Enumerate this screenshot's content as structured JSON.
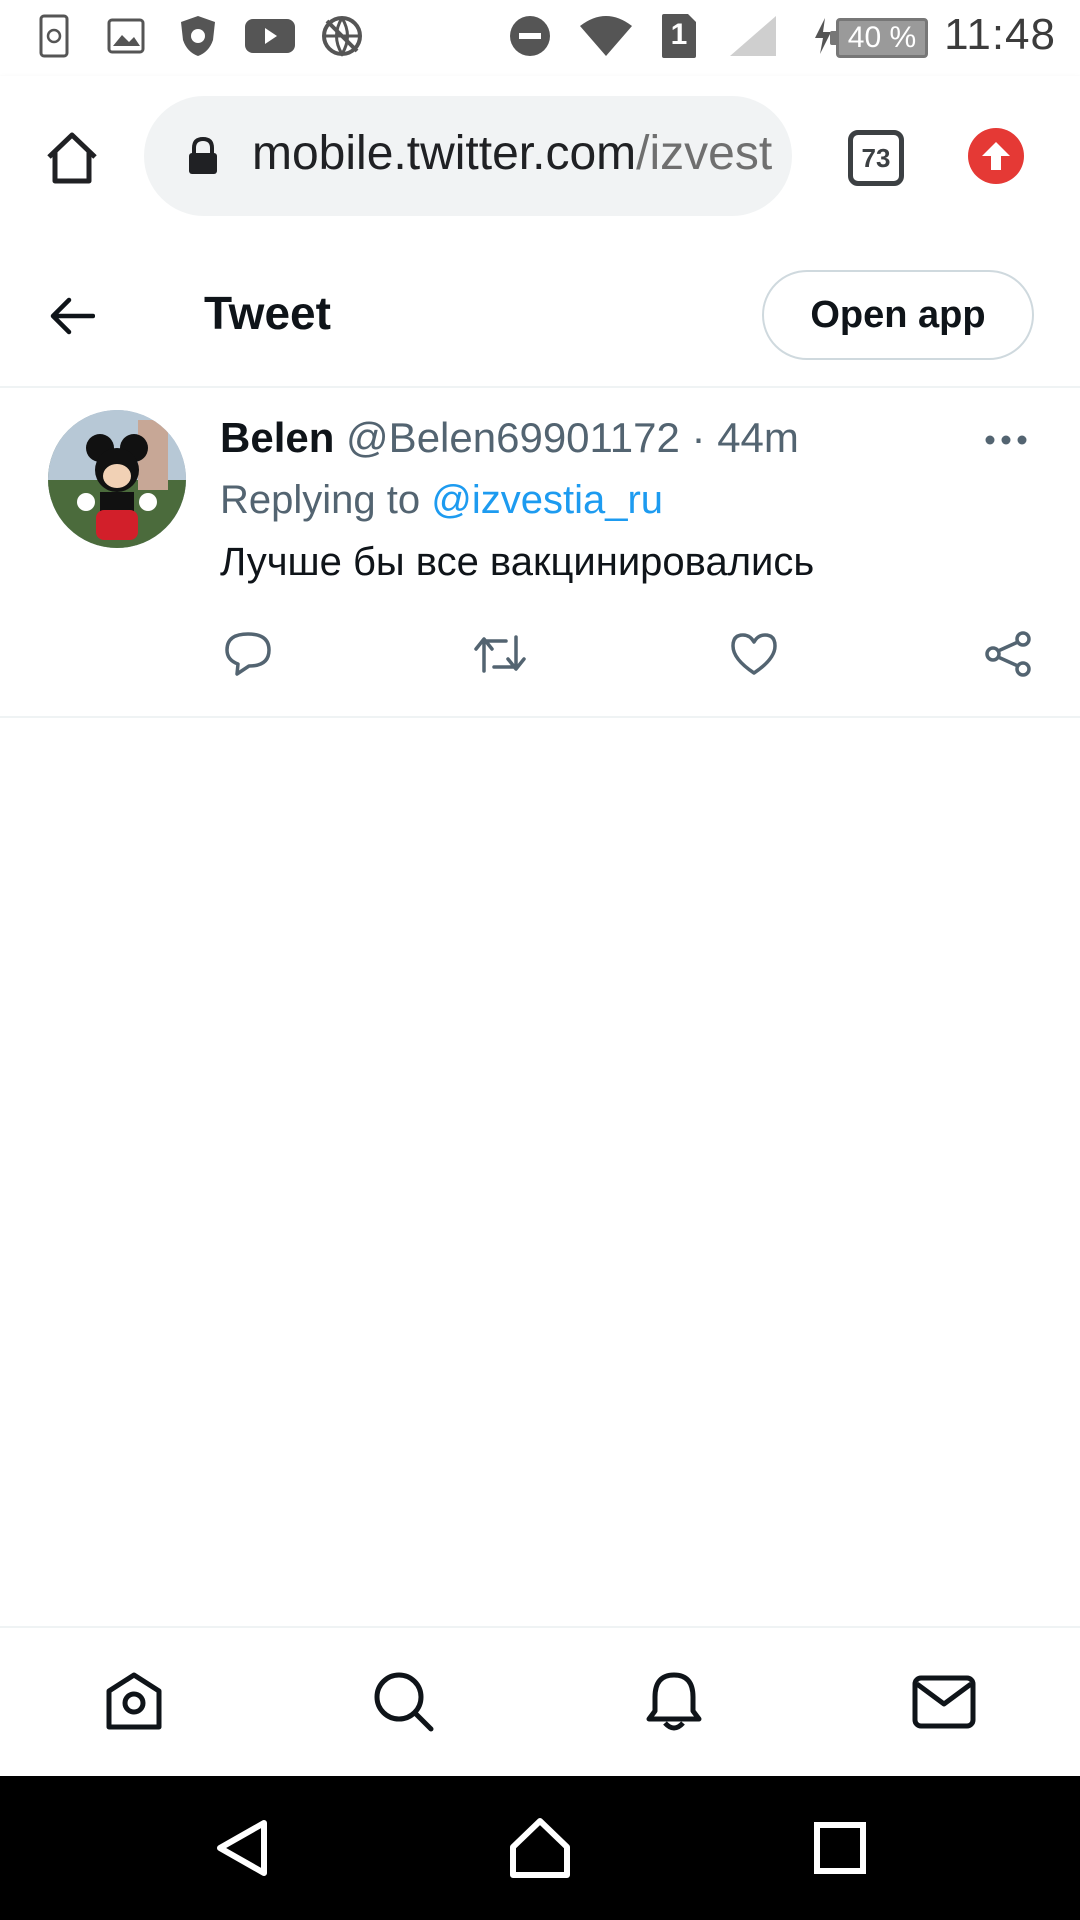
{
  "status_bar": {
    "time": "11:48",
    "battery": "40 %",
    "sim_slot": "1",
    "icons": [
      "sync-icon",
      "image-icon",
      "antivirus-icon",
      "youtube-icon",
      "vpn-globe-icon",
      "do-not-disturb-icon",
      "wifi-icon",
      "sim-icon",
      "signal-icon",
      "charging-icon",
      "battery-icon"
    ]
  },
  "browser": {
    "url_host": "mobile.twitter.com",
    "url_path": "/izvestia_ru",
    "tabs_count": "73",
    "icons": [
      "home-icon",
      "lock-icon",
      "update-arrow-icon"
    ]
  },
  "header": {
    "title": "Tweet",
    "open_app_label": "Open app",
    "back_icon": "arrow-left-icon"
  },
  "tweet": {
    "author_name": "Belen",
    "author_handle": "@Belen69901172",
    "separator": "·",
    "time": "44m",
    "replying_prefix": "Replying to ",
    "replying_to": "@izvestia_ru",
    "text": "Лучше бы все вакцинировались",
    "actions": [
      "reply-icon",
      "retweet-icon",
      "like-icon",
      "share-icon"
    ],
    "accent_color": "#1d9bf0"
  },
  "bottom_nav": {
    "items": [
      "home-icon",
      "search-icon",
      "notifications-icon",
      "messages-icon"
    ]
  },
  "android_nav": {
    "items": [
      "back-triangle-icon",
      "home-circle-icon",
      "recents-square-icon"
    ]
  }
}
